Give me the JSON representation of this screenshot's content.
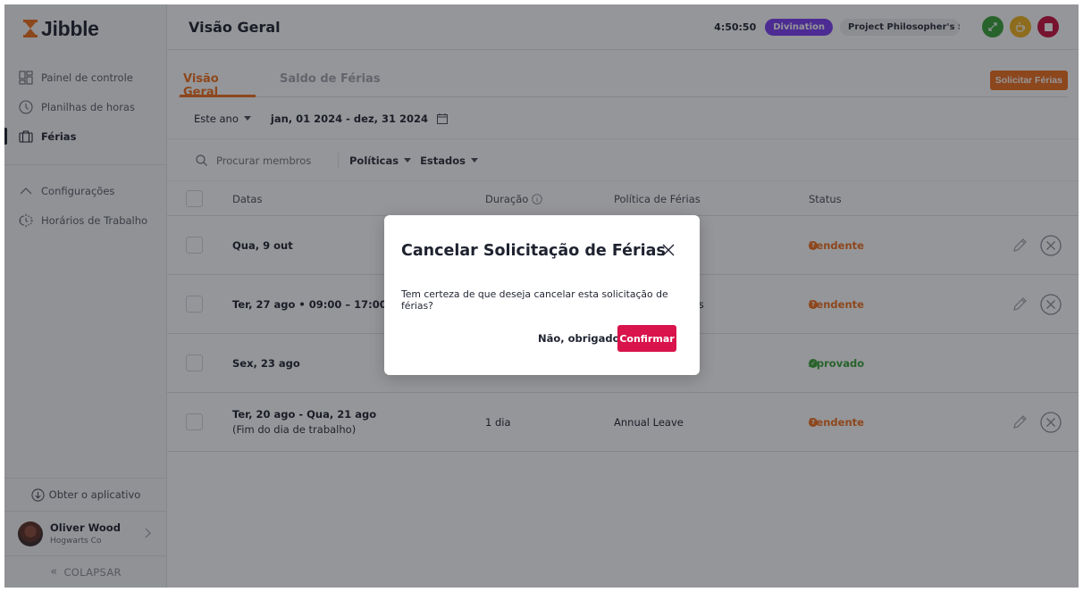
{
  "app": {
    "name": "Jibble",
    "brand_color": "#f0701e"
  },
  "sidebar": {
    "items": [
      {
        "label": "Painel de controle",
        "icon": "dashboard-icon",
        "active": false
      },
      {
        "label": "Planilhas de horas",
        "icon": "clock-icon",
        "active": false
      },
      {
        "label": "Férias",
        "icon": "briefcase-icon",
        "active": true
      }
    ],
    "settings": [
      {
        "label": "Configurações",
        "icon": "chevron-up-icon"
      },
      {
        "label": "Horários de Trabalho",
        "icon": "work-schedule-icon"
      }
    ],
    "get_app_label": "Obter o aplicativo",
    "user": {
      "name": "Oliver Wood",
      "org": "Hogwarts Co"
    },
    "collapse_label": "COLAPSAR"
  },
  "header": {
    "title": "Visão Geral",
    "clock": "4:50:50",
    "activity": "Divination",
    "activity_color": "#7a3ff2",
    "project": "Project Philosopher's S...",
    "buttons": [
      {
        "name": "switch-activity",
        "color": "#3aa33a"
      },
      {
        "name": "break",
        "color": "#f0b21e"
      },
      {
        "name": "clock-out",
        "color": "#c8113f"
      }
    ]
  },
  "tabs": [
    {
      "label": "Visão Geral",
      "active": true
    },
    {
      "label": "Saldo de Férias",
      "active": false
    }
  ],
  "request_button": "Solicitar Férias",
  "date_filter": {
    "period": "Este ano",
    "range": "jan, 01 2024 - dez, 31 2024"
  },
  "filters": {
    "search_placeholder": "Procurar membros",
    "policies_label": "Políticas",
    "states_label": "Estados"
  },
  "table": {
    "columns": [
      "Datas",
      "Duração",
      "Política de Férias",
      "Status"
    ],
    "rows": [
      {
        "date": "Qua, 9 out",
        "sub": "",
        "duration": "",
        "policy": "",
        "status": "Pendente",
        "status_type": "pending",
        "actions": true
      },
      {
        "date": "Ter, 27 ago • 09:00 – 17:00",
        "sub": "",
        "duration": "",
        "policy": "rs",
        "status": "Pendente",
        "status_type": "pending",
        "actions": true
      },
      {
        "date": "Sex, 23 ago",
        "sub": "",
        "duration": "",
        "policy": "",
        "status": "Aprovado",
        "status_type": "approved",
        "actions": false
      },
      {
        "date": "Ter, 20 ago - Qua, 21 ago",
        "sub": "(Fim do dia de trabalho)",
        "duration": "1 dia",
        "policy": "Annual Leave",
        "status": "Pendente",
        "status_type": "pending",
        "actions": true
      }
    ]
  },
  "modal": {
    "title": "Cancelar Solicitação de Férias",
    "body": "Tem certeza de que deseja cancelar esta solicitação de férias?",
    "cancel_label": "Não, obrigado",
    "confirm_label": "Confirmar",
    "confirm_color": "#d9134b"
  }
}
